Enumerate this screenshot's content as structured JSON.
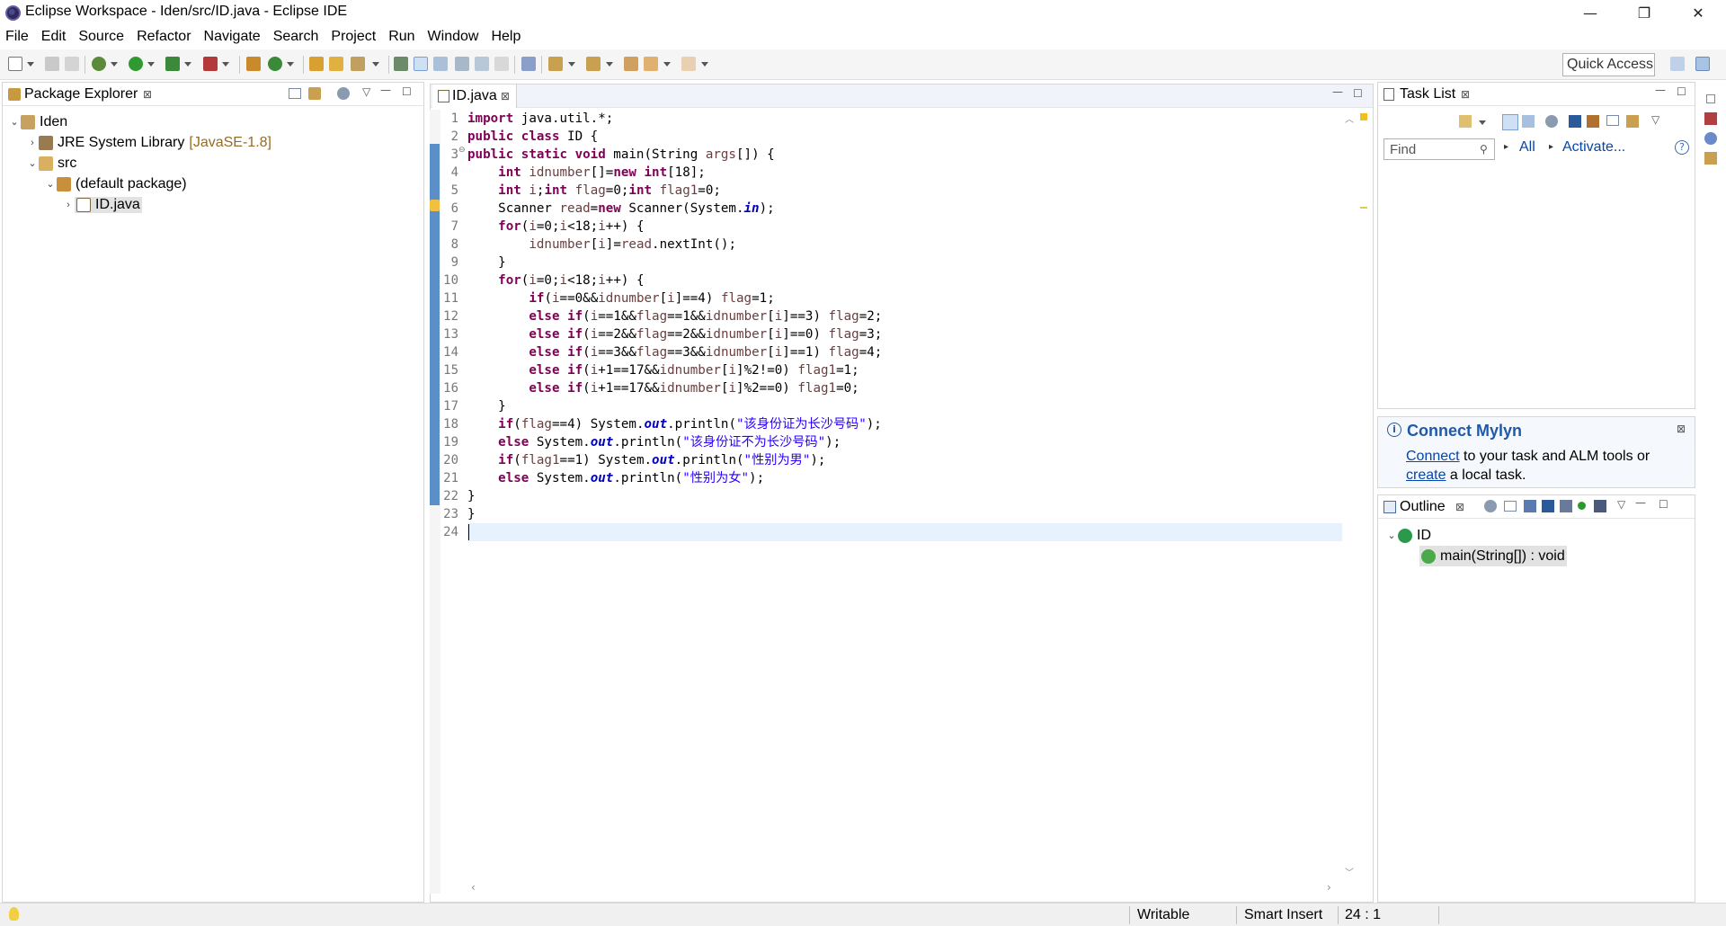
{
  "window": {
    "title": "Eclipse Workspace - Iden/src/ID.java - Eclipse IDE",
    "controls": {
      "minimize": "—",
      "restore": "❐",
      "close": "✕"
    }
  },
  "menu": [
    "File",
    "Edit",
    "Source",
    "Refactor",
    "Navigate",
    "Search",
    "Project",
    "Run",
    "Window",
    "Help"
  ],
  "toolbar": {
    "quick_access": "Quick Access"
  },
  "package_explorer": {
    "title": "Package Explorer",
    "tree": [
      {
        "label": "Iden",
        "depth": 0,
        "expanded": true
      },
      {
        "label": "JRE System Library",
        "suffix": "[JavaSE-1.8]",
        "depth": 1,
        "expanded": false
      },
      {
        "label": "src",
        "depth": 1,
        "expanded": true
      },
      {
        "label": "(default package)",
        "depth": 2,
        "expanded": true
      },
      {
        "label": "ID.java",
        "depth": 3,
        "expanded": false,
        "selected": true
      }
    ]
  },
  "editor": {
    "tab": "ID.java",
    "line_numbers": [
      "1",
      "2",
      "3",
      "4",
      "5",
      "6",
      "7",
      "8",
      "9",
      "10",
      "11",
      "12",
      "13",
      "14",
      "15",
      "16",
      "17",
      "18",
      "19",
      "20",
      "21",
      "22",
      "23",
      "24"
    ],
    "fold_marker": "⊖"
  },
  "task_list": {
    "title": "Task List",
    "find_placeholder": "Find",
    "all_label": "All",
    "activate_label": "Activate..."
  },
  "mylyn": {
    "title": "Connect Mylyn",
    "connect_link": "Connect",
    "text1": " to your task and ALM tools or",
    "create_link": "create",
    "text2": " a local task."
  },
  "outline": {
    "title": "Outline",
    "class_name": "ID",
    "method": "main(String[]) : void"
  },
  "status": {
    "writable": "Writable",
    "insert_mode": "Smart Insert",
    "position": "24 : 1"
  },
  "colors": {
    "keyword": "#7f0055",
    "string": "#2a00ff",
    "field": "#0000c0",
    "change_bar": "#5b8fc8",
    "mylyn_title": "#1e5aa8"
  }
}
